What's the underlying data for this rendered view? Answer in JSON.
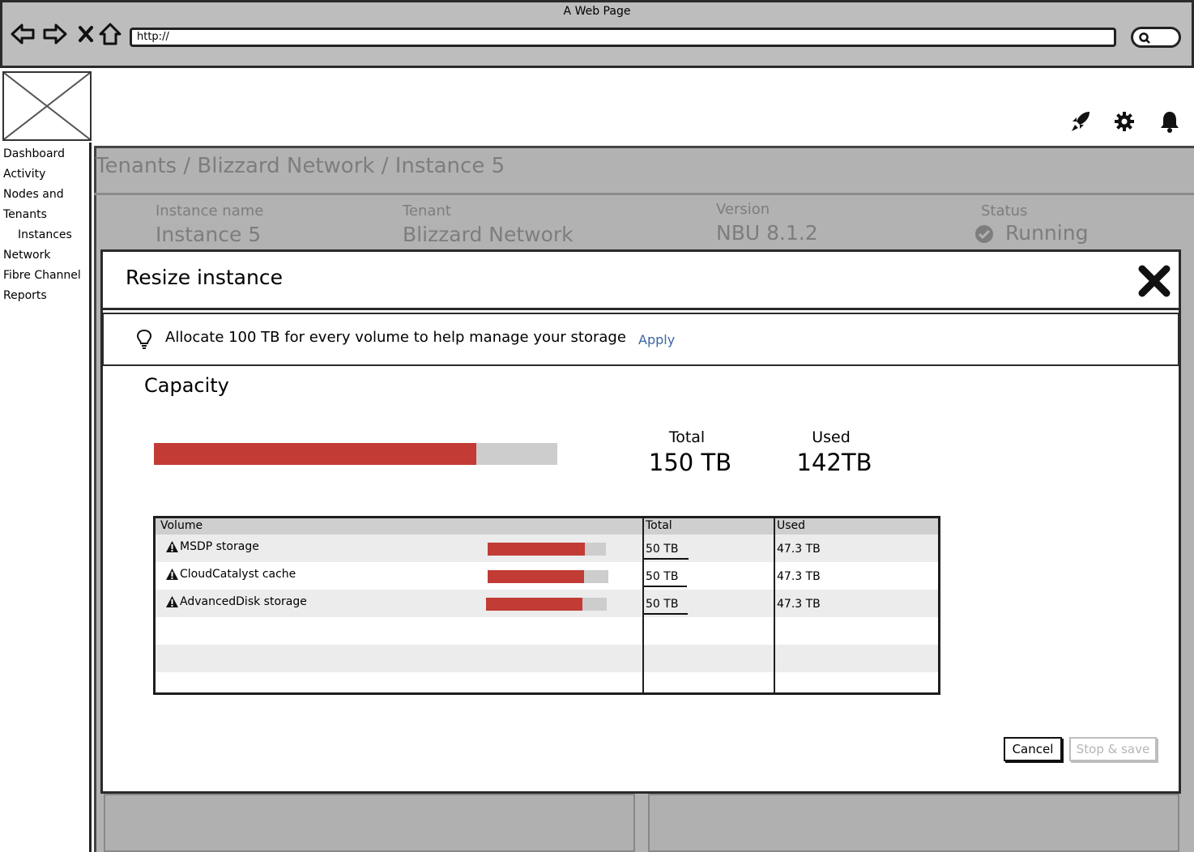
{
  "browser": {
    "title": "A Web Page",
    "url": "http://"
  },
  "sidebar": {
    "items": [
      {
        "label": "Dashboard"
      },
      {
        "label": "Activity"
      },
      {
        "label": "Nodes and"
      },
      {
        "label": "Tenants"
      },
      {
        "label": "Instances"
      },
      {
        "label": "Network"
      },
      {
        "label": "Fibre Channel"
      },
      {
        "label": "Reports"
      }
    ]
  },
  "header_icons": [
    "rocket-icon",
    "gear-icon",
    "bell-icon"
  ],
  "breadcrumb": "Tenants / Blizzard Network / Instance 5",
  "instance_info": {
    "name_label": "Instance name",
    "name_value": "Instance 5",
    "tenant_label": "Tenant",
    "tenant_value": "Blizzard Network",
    "version_label": "Version",
    "version_value": "NBU 8.1.2",
    "status_label": "Status",
    "status_value": "Running"
  },
  "modal": {
    "title": "Resize instance",
    "tip_text": "Allocate 100 TB for every volume to help manage your storage",
    "apply_label": "Apply",
    "capacity_title": "Capacity",
    "capacity_fraction": 0.8,
    "total_label": "Total",
    "total_value": "150 TB",
    "used_label": "Used",
    "used_value": "142TB",
    "table": {
      "headers": [
        "Volume",
        "Total",
        "Used"
      ],
      "rows": [
        {
          "name": "MSDP storage",
          "usage_fraction": 0.82,
          "total": "50 TB",
          "used": "47.3 TB"
        },
        {
          "name": "CloudCatalyst cache",
          "usage_fraction": 0.8,
          "total": "50 TB",
          "used": "47.3 TB"
        },
        {
          "name": "AdvancedDisk storage",
          "usage_fraction": 0.8,
          "total": "50 TB",
          "used": "47.3 TB"
        }
      ]
    },
    "cancel_label": "Cancel",
    "stop_save_label": "Stop & save"
  },
  "colors": {
    "usage_red": "#c23b35",
    "track_gray": "#cdcdcd",
    "link_blue": "#3c67a5"
  }
}
